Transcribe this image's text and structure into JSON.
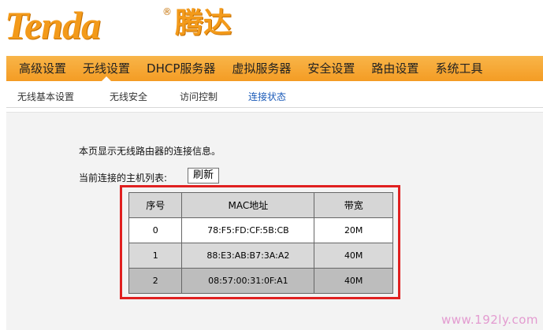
{
  "brand": {
    "name": "Tenda",
    "registered": "®",
    "name_cn": "腾达"
  },
  "main_nav": {
    "items": [
      {
        "label": "高级设置",
        "active": false
      },
      {
        "label": "无线设置",
        "active": true
      },
      {
        "label": "DHCP服务器",
        "active": false
      },
      {
        "label": "虚拟服务器",
        "active": false
      },
      {
        "label": "安全设置",
        "active": false
      },
      {
        "label": "路由设置",
        "active": false
      },
      {
        "label": "系统工具",
        "active": false
      }
    ]
  },
  "sub_nav": {
    "items": [
      {
        "label": "无线基本设置",
        "active": false
      },
      {
        "label": "无线安全",
        "active": false
      },
      {
        "label": "访问控制",
        "active": false
      },
      {
        "label": "连接状态",
        "active": true
      }
    ]
  },
  "content": {
    "intro": "本页显示无线路由器的连接信息。",
    "hosts_label": "当前连接的主机列表:",
    "refresh_label": "刷新",
    "table": {
      "headers": [
        "序号",
        "MAC地址",
        "带宽"
      ],
      "rows": [
        [
          "0",
          "78:F5:FD:CF:5B:CB",
          "20M"
        ],
        [
          "1",
          "88:E3:AB:B7:3A:A2",
          "40M"
        ],
        [
          "2",
          "08:57:00:31:0F:A1",
          "40M"
        ]
      ]
    }
  },
  "watermark": "www.192ly.com",
  "colors": {
    "brand_orange": "#f39a1a",
    "nav_orange": "#f49c24",
    "active_sub": "#1a5ab8",
    "highlight_red": "#e02020"
  }
}
